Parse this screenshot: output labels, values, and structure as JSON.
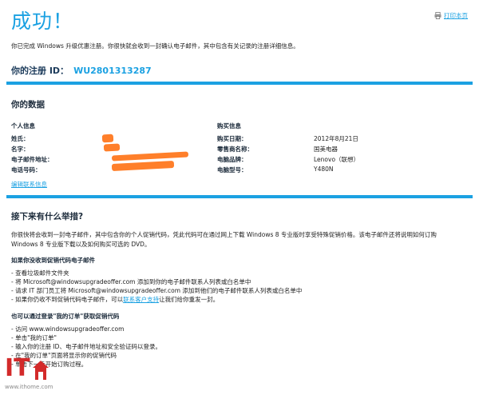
{
  "title": "成功！",
  "print_label": "打印本页",
  "intro": "你已完成 Windows 升级优惠注册。你很快就会收到一封确认电子邮件，其中包含有关记录的注册详细信息。",
  "registration": {
    "label": "你的注册 ID：",
    "id": "WU2801313287"
  },
  "data_section": {
    "heading": "你的数据",
    "personal": {
      "heading": "个人信息",
      "fields": [
        {
          "label": "姓氏：",
          "value": ""
        },
        {
          "label": "名字：",
          "value": ""
        },
        {
          "label": "电子邮件地址：",
          "value": ""
        },
        {
          "label": "电话号码：",
          "value": ""
        }
      ]
    },
    "purchase": {
      "heading": "购买信息",
      "fields": [
        {
          "label": "购买日期：",
          "value": "2012年8月21日"
        },
        {
          "label": "零售商名称：",
          "value": "国美电器"
        },
        {
          "label": "电脑品牌：",
          "value": "Lenovo（联想）"
        },
        {
          "label": "电脑型号：",
          "value": "Y480N"
        }
      ]
    },
    "edit_link": "编辑联系信息"
  },
  "next_section": {
    "heading": "接下来有什么举措?",
    "paragraph_line1": "你很快将会收到一封电子邮件，其中包含你的个人促销代码，凭此代码可在通过网上下载 Windows 8 专业版时享受特殊促销价格。该电子邮件还将说明如何订购",
    "paragraph_line2": "Windows 8 专业版下载以及如何购买可选的 DVD。",
    "not_received": {
      "heading": "如果你没收到促销代码电子邮件",
      "items": [
        "- 查看垃圾邮件文件夹",
        "- 将 Microsoft@windowsupgradeoffer.com 添加到你的电子邮件联系人列表或白名单中",
        "- 请求 IT 部门员工将 Microsoft@windowsupgradeoffer.com 添加到他们的电子邮件联系人列表或白名单中",
        "- 如果你仍收不到促销代码电子邮件，可以"
      ],
      "last_link": "联系客户支持",
      "last_suffix": "让我们给你重发一封。"
    },
    "my_orders": {
      "heading": "也可以通过登录\"我的订单\"获取促销代码",
      "items": [
        "- 访问 www.windowsupgradeoffer.com",
        "- 单击\"我的订单\"",
        "- 输入你的注册 ID、电子邮件地址和安全验证码以登录。",
        "- 在\"我的订单\"页面将显示你的促销代码",
        "- 单击下一步开始订购过程。"
      ]
    }
  },
  "watermark": {
    "brand": "IT",
    "site": "www.ithome.com"
  },
  "colors": {
    "accent": "#1ba1e2",
    "redaction": "#ff7f2a",
    "watermark_red": "#d32a2a"
  }
}
